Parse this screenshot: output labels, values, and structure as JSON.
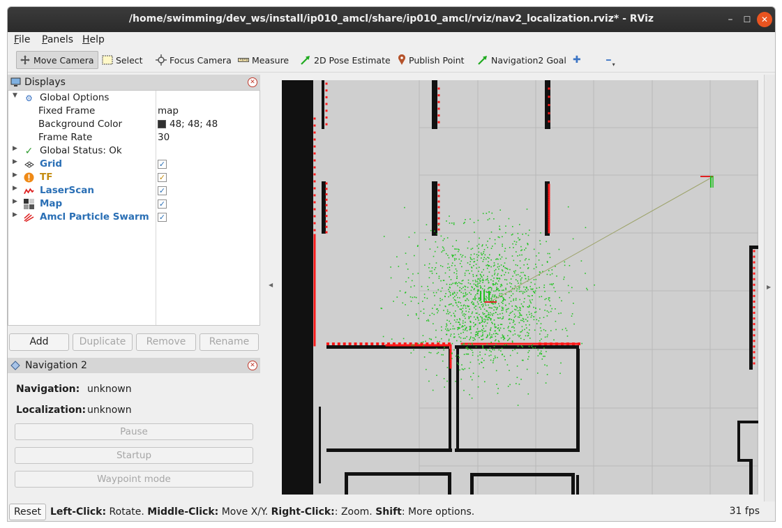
{
  "window": {
    "title": "/home/swimming/dev_ws/install/ip010_amcl/share/ip010_amcl/rviz/nav2_localization.rviz* - RViz",
    "min_glyph": "–",
    "max_glyph": "☐",
    "close_glyph": "✕"
  },
  "menu": {
    "file": {
      "hot": "F",
      "rest": "ile"
    },
    "panels": {
      "hot": "P",
      "rest": "anels"
    },
    "help": {
      "hot": "H",
      "rest": "elp"
    }
  },
  "toolbar": {
    "move_camera": "Move Camera",
    "select": "Select",
    "focus_camera": "Focus Camera",
    "measure": "Measure",
    "pose_estimate": "2D Pose Estimate",
    "publish_point": "Publish Point",
    "nav_goal": "Navigation2 Goal",
    "add_glyph": "✚",
    "remove_glyph": "━",
    "dropdown_glyph": "▾"
  },
  "displays": {
    "header": "Displays",
    "close_glyph": "✕",
    "expanded_glyph": "▼",
    "collapsed_glyph": "▶",
    "global_options": "Global Options",
    "fixed_frame_label": "Fixed Frame",
    "fixed_frame_value": "map",
    "background_color_label": "Background Color",
    "background_color_value": "48; 48; 48",
    "background_color_hex": "#303030",
    "frame_rate_label": "Frame Rate",
    "frame_rate_value": "30",
    "global_status": "Global Status: Ok",
    "check_glyph": "✓",
    "items": [
      {
        "label": "Grid",
        "icon": "grid-icon",
        "checked": true
      },
      {
        "label": "TF",
        "icon": "warning-icon",
        "checked": true
      },
      {
        "label": "LaserScan",
        "icon": "laserscan-icon",
        "checked": true
      },
      {
        "label": "Map",
        "icon": "map-icon",
        "checked": true
      },
      {
        "label": "Amcl Particle Swarm",
        "icon": "particle-swarm-icon",
        "checked": true
      }
    ],
    "buttons": {
      "add": "Add",
      "duplicate": "Duplicate",
      "remove": "Remove",
      "rename": "Rename"
    }
  },
  "navigation": {
    "header": "Navigation 2",
    "navigation_label": "Navigation:",
    "navigation_value": "unknown",
    "localization_label": "Localization:",
    "localization_value": "unknown",
    "pause": "Pause",
    "startup": "Startup",
    "waypoint_mode": "Waypoint mode"
  },
  "status": {
    "reset": "Reset",
    "left_click_label": "Left-Click:",
    "left_click_text": " Rotate. ",
    "middle_click_label": "Middle-Click:",
    "middle_click_text": " Move X/Y. ",
    "right_click_label": "Right-Click:",
    "right_click_text": ": Zoom. ",
    "shift_label": "Shift",
    "shift_text": ": More options.",
    "fps": "31 fps"
  },
  "colors": {
    "accent": "#e95420",
    "display_blue": "#2a6fb5",
    "warning_gold": "#c38b0f",
    "laser_red": "#ff0000",
    "particle_green": "#22c322"
  }
}
